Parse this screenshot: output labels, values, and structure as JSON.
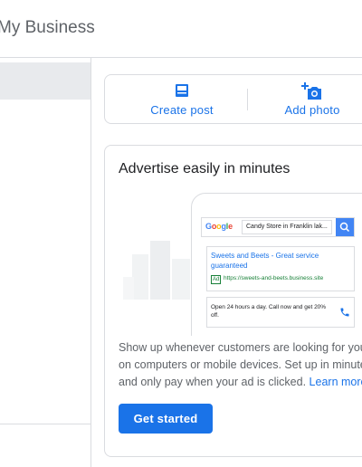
{
  "header": {
    "app_title": "My Business"
  },
  "actions": {
    "create_post_label": "Create post",
    "add_photo_label": "Add photo"
  },
  "ad_card": {
    "title": "Advertise easily in minutes",
    "preview": {
      "logo": "Google",
      "search_text": "Candy Store in Franklin lak...",
      "result_title": "Sweets and Beets - Great service guaranteed",
      "ad_badge": "Ad",
      "result_url": "https://sweets-and-beets.business.site",
      "info_text": "Open 24 hours a day. Call now and get 20% off."
    },
    "description": "Show up whenever customers are looking for you on computers or mobile devices. Set up in minutes, and only pay when your ad is clicked.",
    "learn_more": "Learn more",
    "cta": "Get started"
  },
  "colors": {
    "accent": "#1a73e8",
    "divider": "#dadce0",
    "selected_bg": "#e8eaed"
  },
  "icons": [
    "create-post-icon",
    "add-photo-icon",
    "search-icon",
    "phone-icon"
  ]
}
